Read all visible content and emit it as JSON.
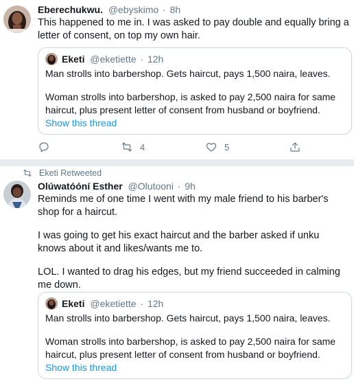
{
  "tweet1": {
    "author_name": "Eberechukwu.",
    "handle": "@ebyskimo",
    "dot": "·",
    "time": "8h",
    "text": "This happened to me in. I was asked to pay double and equally bring a letter of consent, on top my own hair.",
    "quote": {
      "author_name": "Eketi",
      "handle": "@eketiette",
      "dot": "·",
      "time": "12h",
      "para1": "Man strolls into barbershop. Gets haircut, pays 1,500 naira, leaves.",
      "para2": "Woman strolls into barbershop, is asked to pay 2,500 naira for same haircut, plus present letter of consent from husband or boyfriend.",
      "show_thread": "Show this thread"
    },
    "actions": {
      "reply_count": "",
      "retweet_count": "4",
      "like_count": "5"
    }
  },
  "tweet2": {
    "retweeted_by": "Eketi Retweeted",
    "author_name": "Olúwatóóní Esther",
    "handle": "@Olutooni",
    "dot": "·",
    "time": "9h",
    "para1": "Reminds me of one time I went with my male friend to his barber's shop for a haircut.",
    "para2": "I was going to get his exact haircut and the barber asked if unku knows about it and likes/wants me to.",
    "para3": "LOL. I wanted to drag his edges, but my friend succeeded in calming me down.",
    "quote": {
      "author_name": "Eketi",
      "handle": "@eketiette",
      "dot": "·",
      "time": "12h",
      "para1": "Man strolls into barbershop. Gets haircut, pays 1,500 naira, leaves.",
      "para2": "Woman strolls into barbershop, is asked to pay 2,500 naira for same haircut, plus present letter of consent from husband or boyfriend.",
      "show_thread": "Show this thread"
    }
  },
  "colors": {
    "text": "#14171a",
    "secondary": "#657786",
    "link": "#1b95e0",
    "border": "#ccd6dd",
    "divider": "#e6ecf0"
  },
  "icons": [
    "reply-icon",
    "retweet-icon",
    "like-icon",
    "share-icon",
    "retweeted-icon"
  ]
}
